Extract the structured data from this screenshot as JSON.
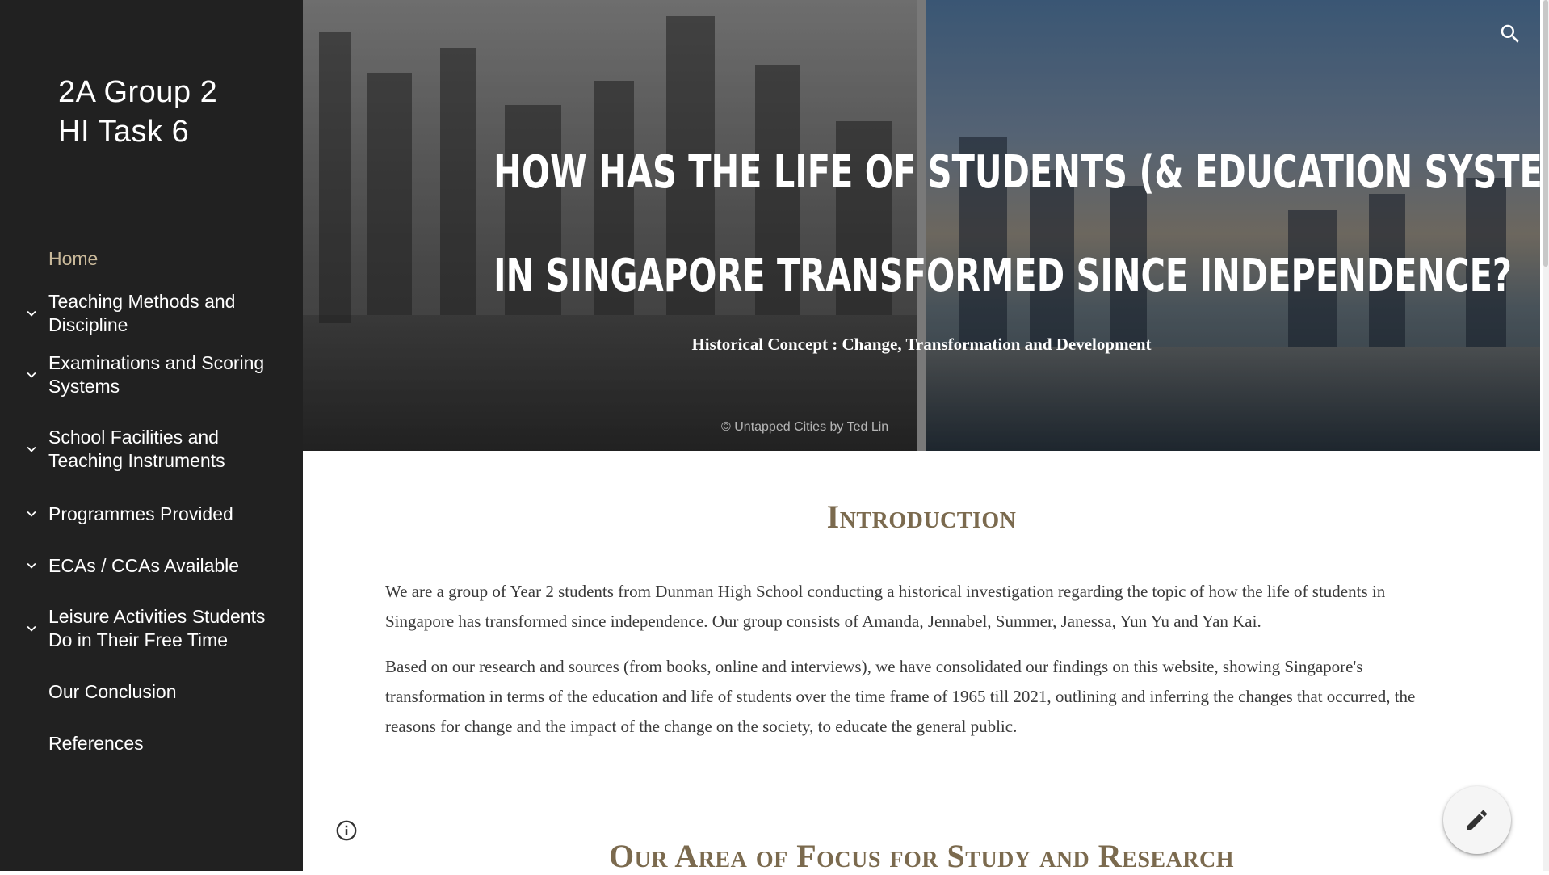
{
  "sidebar": {
    "site_title_line1": "2A Group 2",
    "site_title_line2": "HI Task 6",
    "items": [
      {
        "label": "Home",
        "expandable": false
      },
      {
        "label": "Teaching Methods and Discipline",
        "expandable": true
      },
      {
        "label": "Examinations and Scoring Systems",
        "expandable": true
      },
      {
        "label": "School Facilities and Teaching Instruments",
        "expandable": true
      },
      {
        "label": "Programmes Provided",
        "expandable": true
      },
      {
        "label": "ECAs / CCAs Available",
        "expandable": true
      },
      {
        "label": "Leisure Activities Students Do in Their Free Time",
        "expandable": true
      },
      {
        "label": "Our Conclusion",
        "expandable": false
      },
      {
        "label": "References",
        "expandable": false
      }
    ]
  },
  "header": {
    "headline_line1": "How has the life of students (& education system)",
    "headline_line2": "in Singapore transformed since independence?",
    "subheading": "Historical Concept : Change, Transformation and Development",
    "image_credit": "© Untapped Cities by Ted Lin"
  },
  "content": {
    "intro_title": "Introduction",
    "intro_p1": "We are a group of Year 2 students from Dunman High School conducting a historical investigation regarding the topic of how the life of students in Singapore has transformed since independence. Our group consists of Amanda, Jennabel, Summer, Janessa, Yun Yu and Yan Kai.",
    "intro_p2": "Based on our research and sources (from books, online and interviews), we have consolidated our findings on this website, showing Singapore's transformation in terms of the education and life of students over the time frame of 1965 till 2021, outlining and inferring the changes that occurred, the reasons for change and the impact of the change on the society, to educate the general public.",
    "focus_title": "Our Area of Focus for Study and Research"
  },
  "colors": {
    "sidebar_bg": "#212121",
    "accent": "#7b6a4e",
    "home_active": "#c9b99a"
  },
  "icons": {
    "search": "search-icon",
    "chevron": "chevron-down-icon",
    "info": "info-icon",
    "edit": "pencil-icon"
  }
}
